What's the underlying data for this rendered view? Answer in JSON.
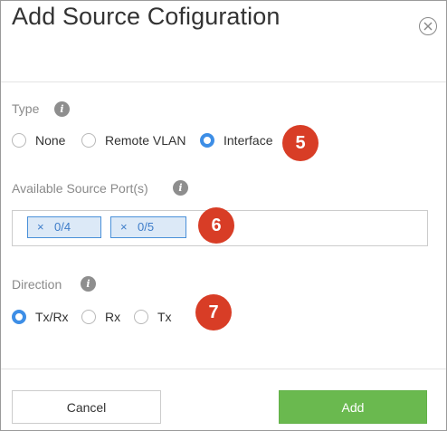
{
  "dialog": {
    "title": "Add Source Cofiguration",
    "close_icon": "close-circle-icon"
  },
  "type_section": {
    "label": "Type",
    "info_glyph": "i",
    "options": [
      {
        "label": "None",
        "selected": false
      },
      {
        "label": "Remote VLAN",
        "selected": false
      },
      {
        "label": "Interface",
        "selected": true
      }
    ],
    "badge": "5"
  },
  "ports_section": {
    "label": "Available Source Port(s)",
    "info_glyph": "i",
    "ports": [
      {
        "remove_glyph": "×",
        "label": "0/4"
      },
      {
        "remove_glyph": "×",
        "label": "0/5"
      }
    ],
    "badge": "6"
  },
  "direction_section": {
    "label": "Direction",
    "info_glyph": "i",
    "options": [
      {
        "label": "Tx/Rx",
        "selected": true
      },
      {
        "label": "Rx",
        "selected": false
      },
      {
        "label": "Tx",
        "selected": false
      }
    ],
    "badge": "7"
  },
  "footer": {
    "cancel_label": "Cancel",
    "add_label": "Add"
  },
  "colors": {
    "accent": "#3d8ee6",
    "add_button": "#6ab94f",
    "badge": "#d83d26",
    "tag_bg": "#dce9f7",
    "tag_border": "#4a90d9"
  }
}
